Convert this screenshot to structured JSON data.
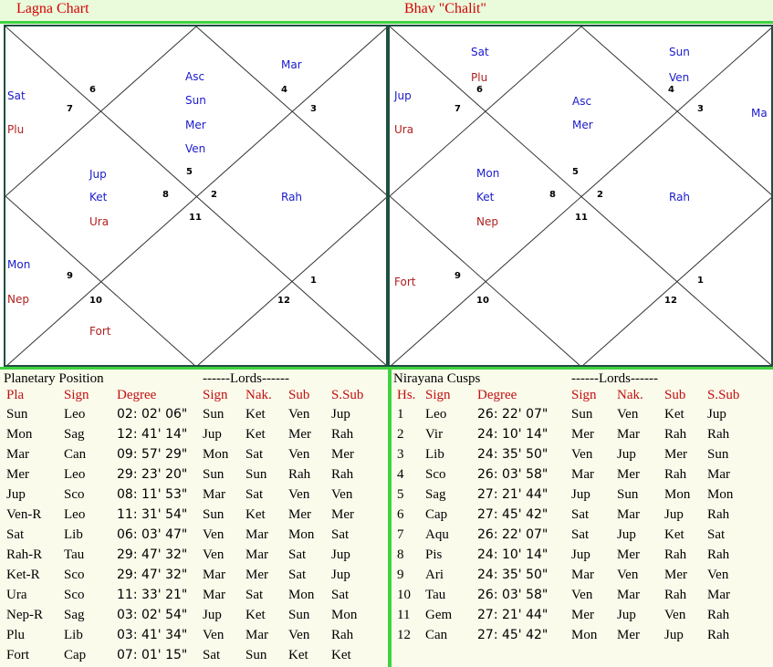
{
  "lagna": {
    "title": "Lagna Chart",
    "nums": [
      "6",
      "7",
      "4",
      "3",
      "5",
      "8",
      "2",
      "11",
      "9",
      "10",
      "1",
      "12"
    ],
    "planets": [
      "Asc",
      "Sun",
      "Mer",
      "Ven",
      "Mar",
      "Sat",
      "Plu",
      "Jup",
      "Ket",
      "Ura",
      "Rah",
      "Mon",
      "Nep",
      "Fort"
    ]
  },
  "bhav": {
    "title": "Bhav \"Chalit\"",
    "nums": [
      "6",
      "7",
      "4",
      "3",
      "5",
      "8",
      "2",
      "11",
      "9",
      "10",
      "1",
      "12"
    ],
    "planets": [
      "Sat",
      "Plu",
      "Sun",
      "Ven",
      "Asc",
      "Mer",
      "Jup",
      "Ura",
      "Ma",
      "Mon",
      "Ket",
      "Nep",
      "Rah",
      "Fort"
    ]
  },
  "planetary": {
    "title": "Planetary Position",
    "lords_title": "------Lords------",
    "headers": [
      "Pla",
      "Sign",
      "Degree",
      "Sign",
      "Nak.",
      "Sub",
      "S.Sub"
    ],
    "rows": [
      [
        "Sun",
        "Leo",
        "02: 02' 06\"",
        "Sun",
        "Ket",
        "Ven",
        "Jup"
      ],
      [
        "Mon",
        "Sag",
        "12: 41' 14\"",
        "Jup",
        "Ket",
        "Mer",
        "Rah"
      ],
      [
        "Mar",
        "Can",
        "09: 57' 29\"",
        "Mon",
        "Sat",
        "Ven",
        "Mer"
      ],
      [
        "Mer",
        "Leo",
        "29: 23' 20\"",
        "Sun",
        "Sun",
        "Rah",
        "Rah"
      ],
      [
        "Jup",
        "Sco",
        "08: 11' 53\"",
        "Mar",
        "Sat",
        "Ven",
        "Ven"
      ],
      [
        "Ven-R",
        "Leo",
        "11: 31' 54\"",
        "Sun",
        "Ket",
        "Mer",
        "Mer"
      ],
      [
        "Sat",
        "Lib",
        "06: 03' 47\"",
        "Ven",
        "Mar",
        "Mon",
        "Sat"
      ],
      [
        "Rah-R",
        "Tau",
        "29: 47' 32\"",
        "Ven",
        "Mar",
        "Sat",
        "Jup"
      ],
      [
        "Ket-R",
        "Sco",
        "29: 47' 32\"",
        "Mar",
        "Mer",
        "Sat",
        "Jup"
      ],
      [
        "Ura",
        "Sco",
        "11: 33' 21\"",
        "Mar",
        "Sat",
        "Mon",
        "Sat"
      ],
      [
        "Nep-R",
        "Sag",
        "03: 02' 54\"",
        "Jup",
        "Ket",
        "Sun",
        "Mon"
      ],
      [
        "Plu",
        "Lib",
        "03: 41' 34\"",
        "Ven",
        "Mar",
        "Ven",
        "Rah"
      ],
      [
        "Fort",
        "Cap",
        "07: 01' 15\"",
        "Sat",
        "Sun",
        "Ket",
        "Ket"
      ]
    ]
  },
  "cusps": {
    "title": "Nirayana Cusps",
    "lords_title": "------Lords------",
    "headers": [
      "Hs.",
      "Sign",
      "Degree",
      "Sign",
      "Nak.",
      "Sub",
      "S.Sub"
    ],
    "rows": [
      [
        "1",
        "Leo",
        "26: 22' 07\"",
        "Sun",
        "Ven",
        "Ket",
        "Jup"
      ],
      [
        "2",
        "Vir",
        "24: 10' 14\"",
        "Mer",
        "Mar",
        "Rah",
        "Rah"
      ],
      [
        "3",
        "Lib",
        "24: 35' 50\"",
        "Ven",
        "Jup",
        "Mer",
        "Sun"
      ],
      [
        "4",
        "Sco",
        "26: 03' 58\"",
        "Mar",
        "Mer",
        "Rah",
        "Mar"
      ],
      [
        "5",
        "Sag",
        "27: 21' 44\"",
        "Jup",
        "Sun",
        "Mon",
        "Mon"
      ],
      [
        "6",
        "Cap",
        "27: 45' 42\"",
        "Sat",
        "Mar",
        "Jup",
        "Rah"
      ],
      [
        "7",
        "Aqu",
        "26: 22' 07\"",
        "Sat",
        "Jup",
        "Ket",
        "Sat"
      ],
      [
        "8",
        "Pis",
        "24: 10' 14\"",
        "Jup",
        "Mer",
        "Rah",
        "Rah"
      ],
      [
        "9",
        "Ari",
        "24: 35' 50\"",
        "Mar",
        "Ven",
        "Mer",
        "Ven"
      ],
      [
        "10",
        "Tau",
        "26: 03' 58\"",
        "Ven",
        "Mar",
        "Rah",
        "Mar"
      ],
      [
        "11",
        "Gem",
        "27: 21' 44\"",
        "Mer",
        "Jup",
        "Ven",
        "Rah"
      ],
      [
        "12",
        "Can",
        "27: 45' 42\"",
        "Mon",
        "Mer",
        "Jup",
        "Rah"
      ]
    ]
  },
  "colors": {
    "header_red": "#d40000",
    "green_border": "#3fd23f",
    "planet_blue": "#1a1acc",
    "planet_red": "#b02020",
    "table_bg": "#fbfbec"
  }
}
